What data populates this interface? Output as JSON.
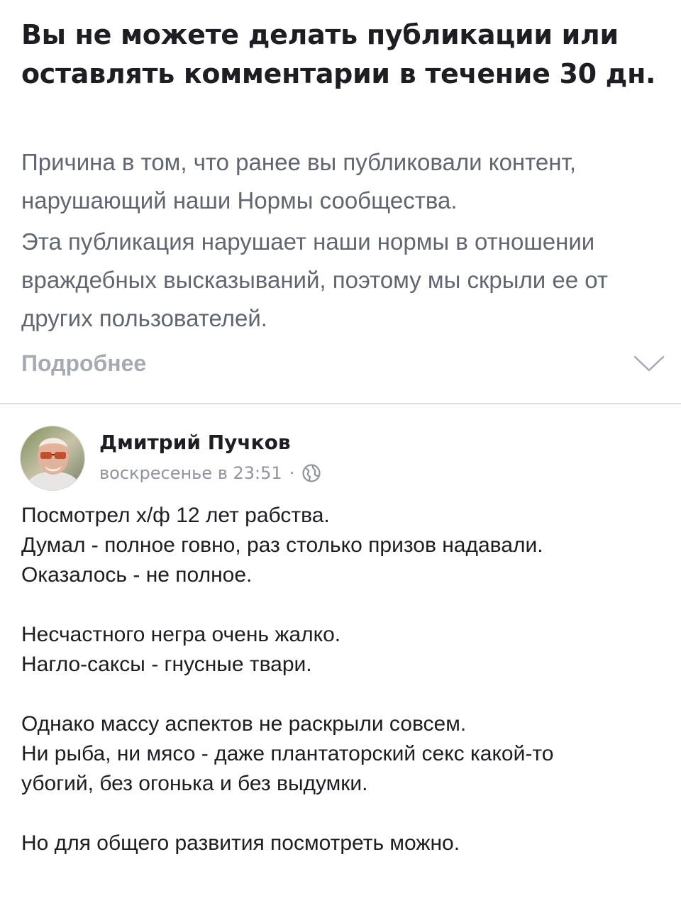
{
  "notice": {
    "title": "Вы не можете делать публикации или оставлять комментарии в течение 30 дн.",
    "reason": "Причина в том, что ранее вы публиковали контент, нарушающий наши Нормы сообщества.",
    "violation": "Эта публикация нарушает наши нормы в отношении враждебных высказываний, поэтому мы скрыли ее от других пользователей.",
    "more_label": "Подробнее",
    "more_icon": "chevron-down-icon"
  },
  "post": {
    "author": "Дмитрий Пучков",
    "timestamp": "воскресенье в 23:51",
    "separator": "·",
    "privacy_icon": "globe-icon",
    "lines": [
      "Посмотрел х/ф 12 лет рабства.",
      "Думал - полное говно, раз столько призов надавали.",
      "Оказалось - не полное.",
      "",
      "Несчастного негра очень жалко.",
      "Нагло-саксы - гнусные твари.",
      "",
      "Однако массу аспектов не раскрыли совсем.",
      "Ни рыба, ни мясо - даже плантаторский секс какой-то",
      "убогий, без огонька и без выдумки.",
      "",
      "Но для общего развития посмотреть можно."
    ]
  },
  "colors": {
    "primary_text": "#1c1e21",
    "secondary_text": "#606770",
    "muted_text": "#a6abb2",
    "meta_text": "#90949c",
    "divider": "#dddfe2"
  }
}
